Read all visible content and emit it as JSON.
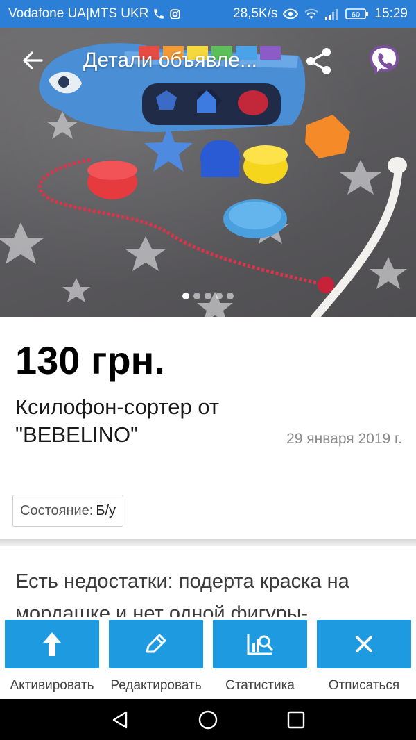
{
  "status_bar": {
    "carrier": "Vodafone UA|MTS UKR",
    "speed": "28,5K/s",
    "battery": "60",
    "time": "15:29",
    "icons": [
      "call-icon",
      "instagram-icon",
      "eye-icon",
      "wifi-icon",
      "signal-icon",
      "battery-icon"
    ]
  },
  "toolbar": {
    "title": "Детали объявле...",
    "icons": [
      "back-arrow-icon",
      "share-icon",
      "viber-icon"
    ]
  },
  "gallery": {
    "image": "toy-xylophone-sorter-photo",
    "pages": 5,
    "active_page": 1
  },
  "listing": {
    "price": "130 грн.",
    "title": "Ксилофон-сортер от \"BEBELINO\"",
    "date": "29 января 2019 г.",
    "condition_label": "Состояние:",
    "condition_value": "Б/у",
    "description": "Есть недостатки: подерта краска на мордашке и нет одной фигуры-"
  },
  "actions": [
    {
      "label": "Активировать",
      "icon": "arrow-up-icon"
    },
    {
      "label": "Редактировать",
      "icon": "pencil-icon"
    },
    {
      "label": "Статистика",
      "icon": "statistics-icon"
    },
    {
      "label": "Отписаться",
      "icon": "close-icon"
    }
  ],
  "colors": {
    "status_bar": "#2c7fd6",
    "action_tile": "#1e9be0",
    "viber": "#7b519d",
    "nav_bar": "#000000"
  }
}
